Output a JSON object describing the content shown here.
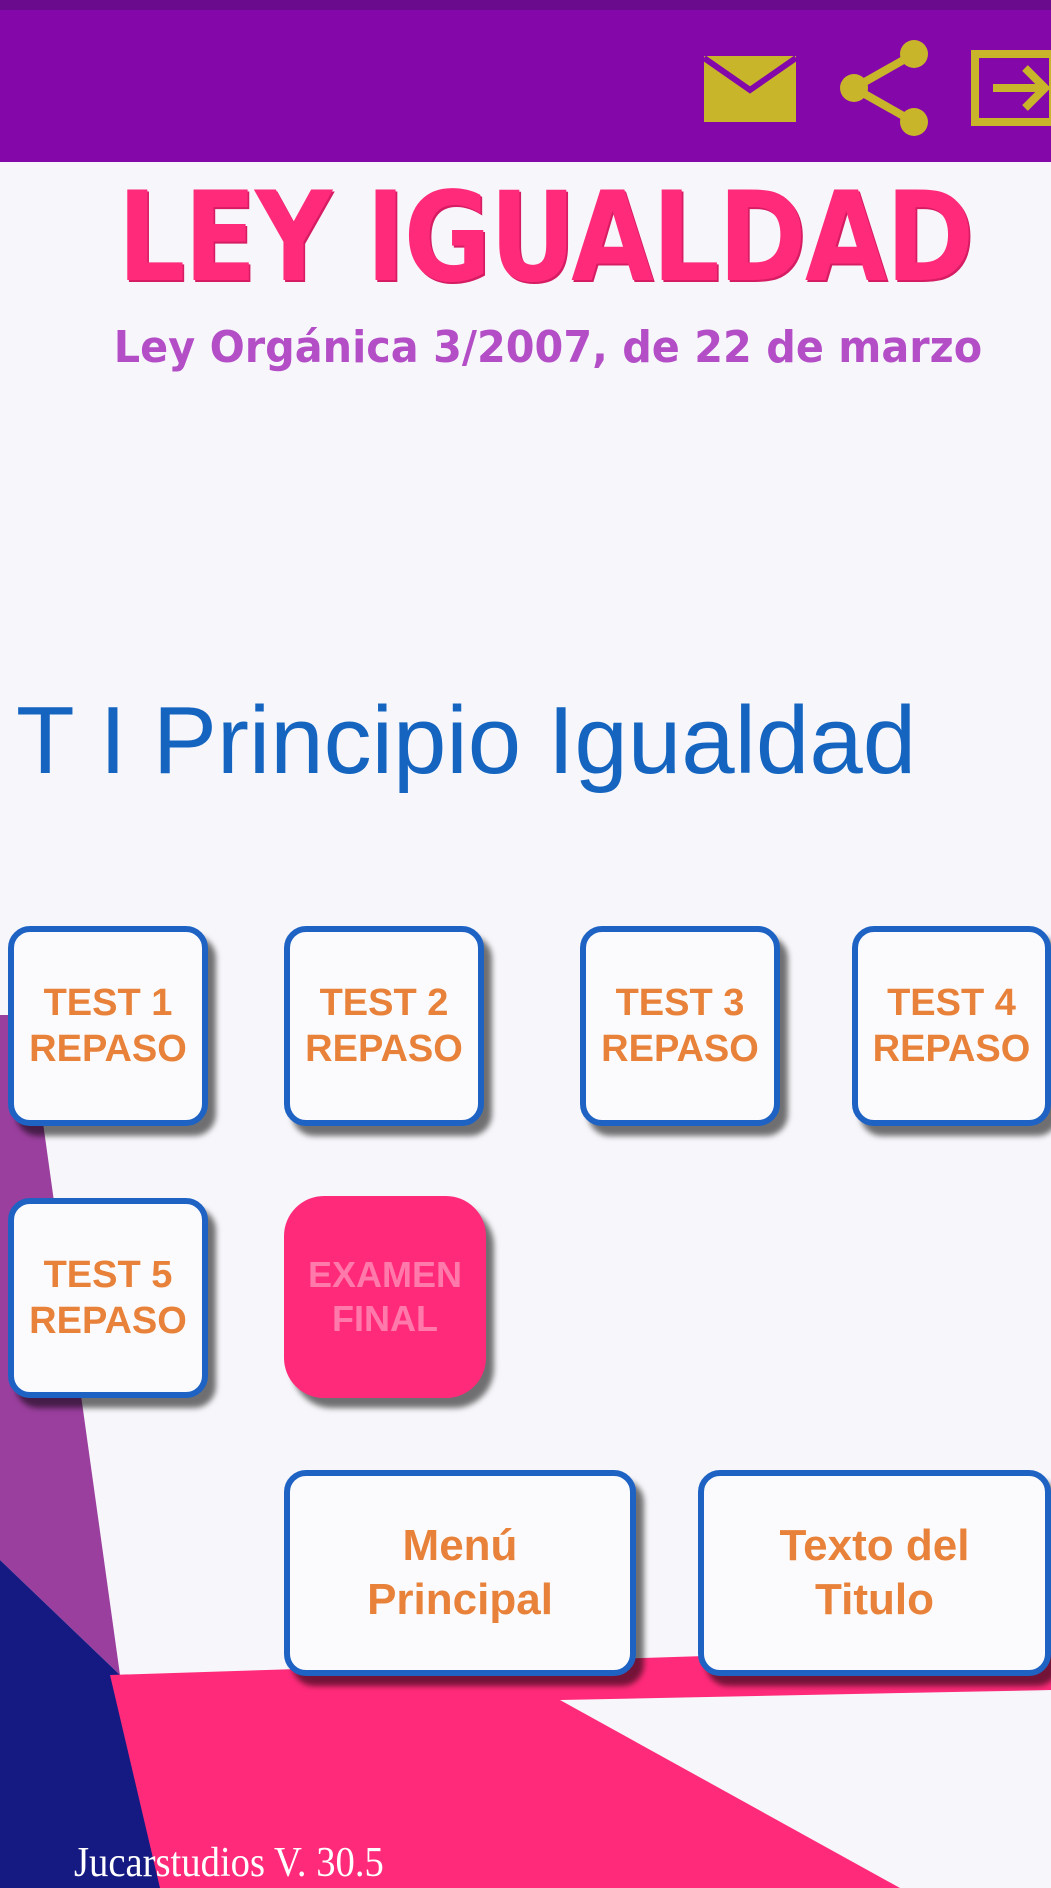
{
  "app": {
    "title": "LEY IGUALDAD",
    "subtitle": "Ley Orgánica 3/2007, de 22 de marzo"
  },
  "toolbar": {
    "icons": [
      "mail-icon",
      "share-icon",
      "exit-icon"
    ],
    "icon_color": "#c9b52a",
    "bar_color": "#8407aa"
  },
  "section": {
    "title": "T I Principio Igualdad"
  },
  "tests": [
    {
      "label": "TEST 1\nREPASO"
    },
    {
      "label": "TEST 2\nREPASO"
    },
    {
      "label": "TEST 3\nREPASO"
    },
    {
      "label": "TEST 4\nREPASO"
    },
    {
      "label": "TEST 5\nREPASO"
    }
  ],
  "exam": {
    "label": "EXAMEN\nFINAL"
  },
  "nav": {
    "menu_label": "Menú\nPrincipal",
    "text_label": "Texto del\nTitulo"
  },
  "footer": {
    "version": "Jucarstudios V. 30.5"
  },
  "colors": {
    "title_pink": "#ff2b7a",
    "subtitle_purple": "#b34ec7",
    "section_blue": "#1565c0",
    "tile_border": "#1e63c4",
    "tile_text": "#e8823a"
  }
}
